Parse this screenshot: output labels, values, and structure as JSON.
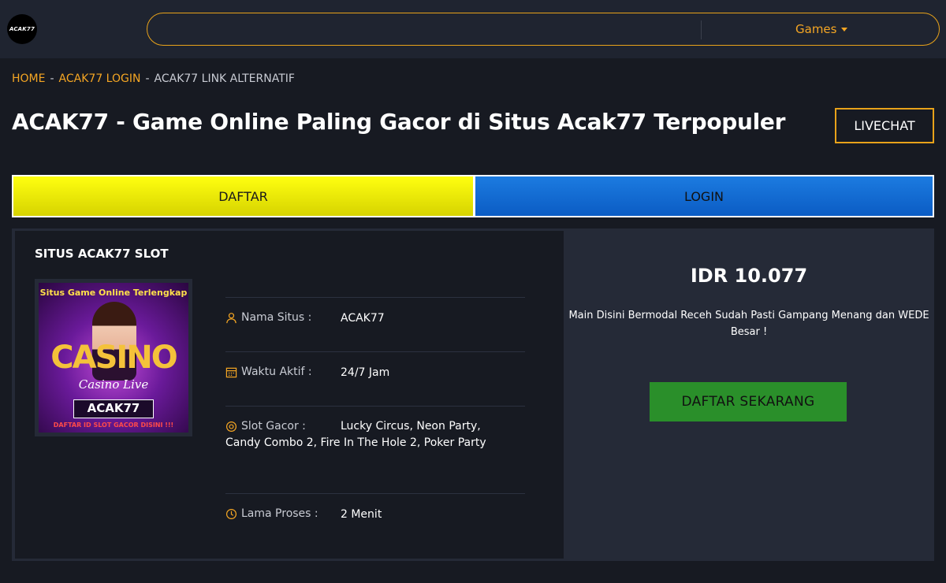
{
  "header": {
    "logo_text": "ACAK77",
    "nav_games_label": "Games"
  },
  "breadcrumb": {
    "items": [
      "HOME",
      "ACAK77 LOGIN",
      "ACAK77 LINK ALTERNATIF"
    ],
    "separator": "-"
  },
  "page": {
    "title": "ACAK77 - Game Online Paling Gacor di Situs Acak77 Terpopuler",
    "livechat_label": "LIVECHAT"
  },
  "actions": {
    "daftar_label": "DAFTAR",
    "login_label": "LOGIN"
  },
  "panel": {
    "section_title": "SITUS ACAK77 SLOT",
    "banner": {
      "top_text": "Situs Game Online Terlengkap",
      "casino_text": "CASINO",
      "live_text": "Casino Live",
      "logo_text": "ACAK77",
      "bottom_text": "DAFTAR ID SLOT GACOR DISINI !!!"
    },
    "info": [
      {
        "icon": "user-icon",
        "label": "Nama Situs :",
        "value": "ACAK77"
      },
      {
        "icon": "calendar-icon",
        "label": "Waktu Aktif :",
        "value": "24/7 Jam"
      },
      {
        "icon": "target-icon",
        "label": "Slot Gacor :",
        "value": "Lucky Circus, Neon Party, Candy Combo 2, Fire In The Hole 2, Poker Party"
      },
      {
        "icon": "clock-icon",
        "label": "Lama Proses :",
        "value": "2 Menit"
      }
    ],
    "price": "IDR 10.077",
    "tagline": "Main Disini Bermodal Receh Sudah Pasti Gampang Menang dan WEDE Besar !",
    "cta_label": "DAFTAR SEKARANG"
  },
  "colors": {
    "accent": "#f5a623",
    "daftar_yellow": "#ffff10",
    "login_blue": "#1c7be0",
    "cta_green": "#2a8f2a",
    "background": "#171a22"
  }
}
